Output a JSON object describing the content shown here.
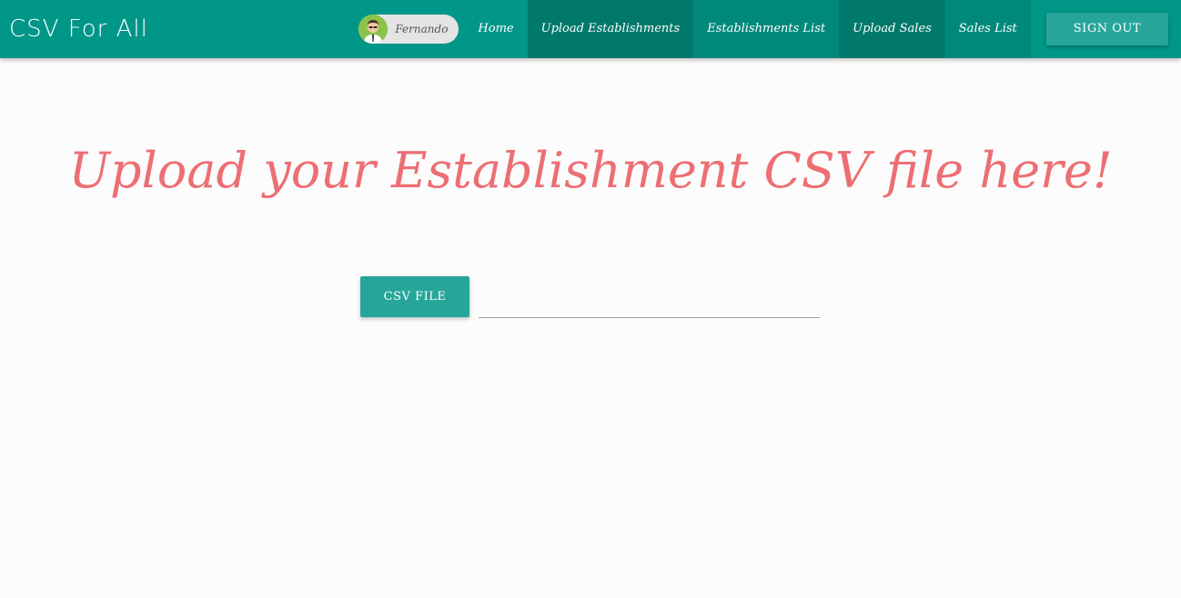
{
  "navbar": {
    "brand": "CSV For All",
    "user": {
      "name": "Fernando",
      "avatar_icon": "user-avatar-icon"
    },
    "items": [
      {
        "label": "Home",
        "state": "normal"
      },
      {
        "label": "Upload Establishments",
        "state": "active"
      },
      {
        "label": "Establishments List",
        "state": "shaded"
      },
      {
        "label": "Upload Sales",
        "state": "active"
      },
      {
        "label": "Sales List",
        "state": "shaded"
      }
    ],
    "sign_out_label": "SIGN OUT"
  },
  "main": {
    "title": "Upload your Establishment CSV file here!",
    "file_button_label": "CSV FILE",
    "file_path_value": "",
    "file_path_placeholder": ""
  },
  "colors": {
    "navbar": "#009688",
    "nav_active": "#00796b",
    "button": "#26a69a",
    "title": "#ec6f73"
  }
}
